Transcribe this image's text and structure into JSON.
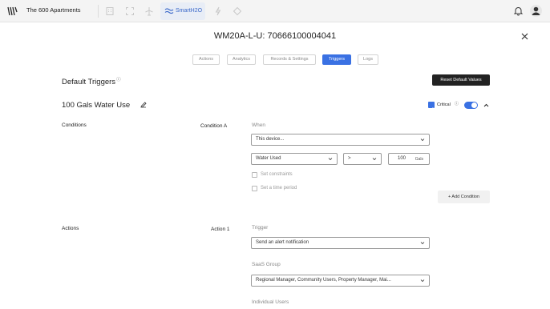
{
  "topbar": {
    "property_name": "The 600 Apartments",
    "active_app": "SmartH2O",
    "nav_icons": [
      "building-icon",
      "expand-icon",
      "plane-icon",
      "lightning-icon",
      "diamond-icon"
    ]
  },
  "modal": {
    "title": "WM20A-L-U: 70666100004041",
    "tabs": [
      {
        "label": "Actions",
        "active": false
      },
      {
        "label": "Analytics",
        "active": false
      },
      {
        "label": "Records & Settings",
        "active": false
      },
      {
        "label": "Triggers",
        "active": true
      },
      {
        "label": "Logs",
        "active": false
      }
    ]
  },
  "default_triggers": {
    "title": "Default Triggers",
    "info": "ⓘ",
    "reset_label": "Reset Default Values"
  },
  "trigger": {
    "name": "100 Gals Water Use",
    "critical_label": "Critical",
    "critical_checked": true,
    "enabled": true,
    "info": "ⓘ"
  },
  "conditions": {
    "section_label": "Conditions",
    "condition_label": "Condition A",
    "when_label": "When",
    "device_select": "This device...",
    "metric_select": "Water Used",
    "operator_select": ">",
    "threshold_value": "100",
    "threshold_unit": "Gals",
    "set_constraints_label": "Set constraints",
    "set_time_period_label": "Set a time period",
    "add_condition_label": "+ Add Condition"
  },
  "actions": {
    "section_label": "Actions",
    "action_label": "Action 1",
    "trigger_label": "Trigger",
    "trigger_select": "Send an alert notification",
    "saas_group_label": "SaaS Group",
    "saas_group_select": "Regional Manager, Community Users, Property Manager, Mai...",
    "individual_users_label": "Individual Users"
  },
  "colors": {
    "accent": "#3a71e3",
    "dark_button": "#222222",
    "topbar_bg": "#f4f4f4"
  }
}
